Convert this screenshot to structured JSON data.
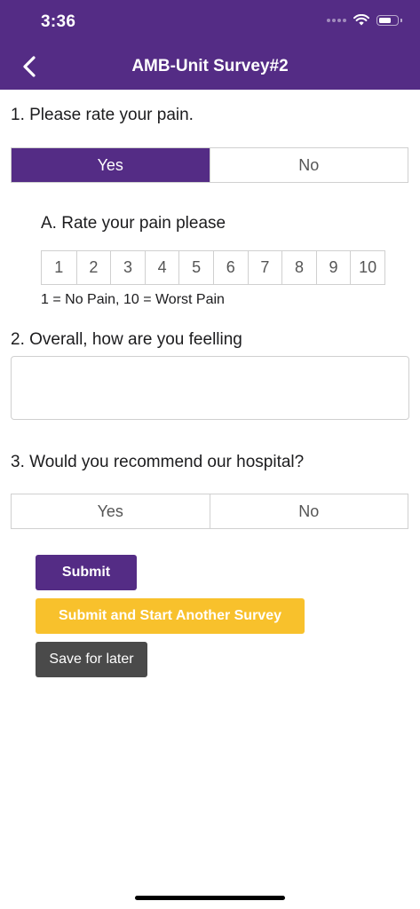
{
  "status_bar": {
    "time": "3:36"
  },
  "nav": {
    "title": "AMB-Unit Survey#2",
    "back_icon": "chevron-left-icon"
  },
  "colors": {
    "primary": "#542c85",
    "accent": "#f8c12c",
    "secondary": "#4a4a4a"
  },
  "q1": {
    "text": "1. Please rate your pain.",
    "options": [
      "Yes",
      "No"
    ],
    "selected": "Yes"
  },
  "q1a": {
    "text": "A. Rate your pain please",
    "scale": [
      "1",
      "2",
      "3",
      "4",
      "5",
      "6",
      "7",
      "8",
      "9",
      "10"
    ],
    "legend": "1 =  No Pain, 10 = Worst Pain"
  },
  "q2": {
    "text": "2. Overall, how are you feelling",
    "value": ""
  },
  "q3": {
    "text": "3. Would you recommend our hospital?",
    "options": [
      "Yes",
      "No"
    ],
    "selected": null
  },
  "actions": {
    "submit": "Submit",
    "submit_another": "Submit and Start Another Survey",
    "save_later": "Save for later"
  }
}
